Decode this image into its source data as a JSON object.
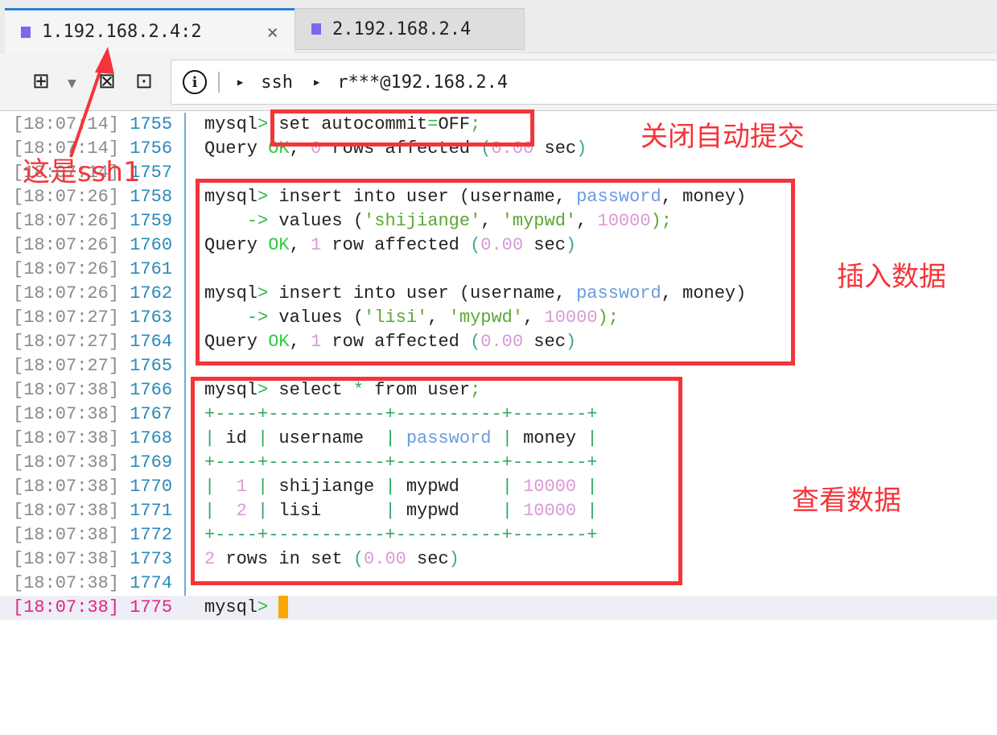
{
  "tabs": [
    {
      "label": "1.192.168.2.4:2",
      "active": true,
      "close": "×"
    },
    {
      "label": "2.192.168.2.4",
      "active": false
    }
  ],
  "toolbar": {
    "breadcrumb": [
      "ssh",
      "r***@192.168.2.4"
    ]
  },
  "colors": {
    "d": "#222222",
    "g": "#2fb84a",
    "k": "#2ecc40",
    "p": "#d99bd6",
    "b": "#6b9be0",
    "c": "#3aa88a",
    "s": "#5aa832",
    "t": "#2fa860"
  },
  "terminal": {
    "lines": [
      {
        "ts": "[18:07:14]",
        "n": "1755",
        "seg": [
          [
            "mysql",
            "d"
          ],
          [
            ">",
            "g"
          ],
          [
            " set autocommit",
            "d"
          ],
          [
            "=",
            "g"
          ],
          [
            "OFF",
            "d"
          ],
          [
            ";",
            "s"
          ]
        ]
      },
      {
        "ts": "[18:07:14]",
        "n": "1756",
        "seg": [
          [
            "Query ",
            "d"
          ],
          [
            "OK",
            "k"
          ],
          [
            ", ",
            "d"
          ],
          [
            "0",
            "p"
          ],
          [
            " rows affected ",
            "d"
          ],
          [
            "(",
            "c"
          ],
          [
            "0.00",
            "p"
          ],
          [
            " sec",
            "d"
          ],
          [
            ")",
            "c"
          ]
        ]
      },
      {
        "ts": "[18:07:14]",
        "n": "1757",
        "seg": []
      },
      {
        "ts": "[18:07:26]",
        "n": "1758",
        "seg": [
          [
            "mysql",
            "d"
          ],
          [
            ">",
            "g"
          ],
          [
            " insert into user (username, ",
            "d"
          ],
          [
            "password",
            "b"
          ],
          [
            ", money)",
            "d"
          ]
        ]
      },
      {
        "ts": "[18:07:26]",
        "n": "1759",
        "seg": [
          [
            "    ",
            "d"
          ],
          [
            "->",
            "g"
          ],
          [
            " values (",
            "d"
          ],
          [
            "'shijiange'",
            "s"
          ],
          [
            ", ",
            "d"
          ],
          [
            "'mypwd'",
            "s"
          ],
          [
            ", ",
            "d"
          ],
          [
            "10000",
            "p"
          ],
          [
            ");",
            "s"
          ]
        ]
      },
      {
        "ts": "[18:07:26]",
        "n": "1760",
        "seg": [
          [
            "Query ",
            "d"
          ],
          [
            "OK",
            "k"
          ],
          [
            ", ",
            "d"
          ],
          [
            "1",
            "p"
          ],
          [
            " row affected ",
            "d"
          ],
          [
            "(",
            "c"
          ],
          [
            "0.00",
            "p"
          ],
          [
            " sec",
            "d"
          ],
          [
            ")",
            "c"
          ]
        ]
      },
      {
        "ts": "[18:07:26]",
        "n": "1761",
        "seg": []
      },
      {
        "ts": "[18:07:26]",
        "n": "1762",
        "seg": [
          [
            "mysql",
            "d"
          ],
          [
            ">",
            "g"
          ],
          [
            " insert into user (username, ",
            "d"
          ],
          [
            "password",
            "b"
          ],
          [
            ", money)",
            "d"
          ]
        ]
      },
      {
        "ts": "[18:07:27]",
        "n": "1763",
        "seg": [
          [
            "    ",
            "d"
          ],
          [
            "->",
            "g"
          ],
          [
            " values (",
            "d"
          ],
          [
            "'lisi'",
            "s"
          ],
          [
            ", ",
            "d"
          ],
          [
            "'mypwd'",
            "s"
          ],
          [
            ", ",
            "d"
          ],
          [
            "10000",
            "p"
          ],
          [
            ");",
            "s"
          ]
        ]
      },
      {
        "ts": "[18:07:27]",
        "n": "1764",
        "seg": [
          [
            "Query ",
            "d"
          ],
          [
            "OK",
            "k"
          ],
          [
            ", ",
            "d"
          ],
          [
            "1",
            "p"
          ],
          [
            " row affected ",
            "d"
          ],
          [
            "(",
            "c"
          ],
          [
            "0.00",
            "p"
          ],
          [
            " sec",
            "d"
          ],
          [
            ")",
            "c"
          ]
        ]
      },
      {
        "ts": "[18:07:27]",
        "n": "1765",
        "seg": []
      },
      {
        "ts": "[18:07:38]",
        "n": "1766",
        "seg": [
          [
            "mysql",
            "d"
          ],
          [
            ">",
            "g"
          ],
          [
            " select ",
            "d"
          ],
          [
            "*",
            "t"
          ],
          [
            " from user",
            "d"
          ],
          [
            ";",
            "s"
          ]
        ]
      },
      {
        "ts": "[18:07:38]",
        "n": "1767",
        "seg": [
          [
            "+----+-----------+----------+-------+",
            "t"
          ]
        ]
      },
      {
        "ts": "[18:07:38]",
        "n": "1768",
        "seg": [
          [
            "|",
            "t"
          ],
          [
            " id ",
            "d"
          ],
          [
            "|",
            "t"
          ],
          [
            " username  ",
            "d"
          ],
          [
            "|",
            "t"
          ],
          [
            " ",
            "d"
          ],
          [
            "password",
            "b"
          ],
          [
            " ",
            "d"
          ],
          [
            "|",
            "t"
          ],
          [
            " money ",
            "d"
          ],
          [
            "|",
            "t"
          ]
        ]
      },
      {
        "ts": "[18:07:38]",
        "n": "1769",
        "seg": [
          [
            "+----+-----------+----------+-------+",
            "t"
          ]
        ]
      },
      {
        "ts": "[18:07:38]",
        "n": "1770",
        "seg": [
          [
            "|",
            "t"
          ],
          [
            "  ",
            "d"
          ],
          [
            "1",
            "p"
          ],
          [
            " ",
            "d"
          ],
          [
            "|",
            "t"
          ],
          [
            " shijiange ",
            "d"
          ],
          [
            "|",
            "t"
          ],
          [
            " mypwd    ",
            "d"
          ],
          [
            "|",
            "t"
          ],
          [
            " ",
            "d"
          ],
          [
            "10000",
            "p"
          ],
          [
            " ",
            "d"
          ],
          [
            "|",
            "t"
          ]
        ]
      },
      {
        "ts": "[18:07:38]",
        "n": "1771",
        "seg": [
          [
            "|",
            "t"
          ],
          [
            "  ",
            "d"
          ],
          [
            "2",
            "p"
          ],
          [
            " ",
            "d"
          ],
          [
            "|",
            "t"
          ],
          [
            " lisi      ",
            "d"
          ],
          [
            "|",
            "t"
          ],
          [
            " mypwd    ",
            "d"
          ],
          [
            "|",
            "t"
          ],
          [
            " ",
            "d"
          ],
          [
            "10000",
            "p"
          ],
          [
            " ",
            "d"
          ],
          [
            "|",
            "t"
          ]
        ]
      },
      {
        "ts": "[18:07:38]",
        "n": "1772",
        "seg": [
          [
            "+----+-----------+----------+-------+",
            "t"
          ]
        ]
      },
      {
        "ts": "[18:07:38]",
        "n": "1773",
        "seg": [
          [
            "2",
            "p"
          ],
          [
            " rows in set ",
            "d"
          ],
          [
            "(",
            "c"
          ],
          [
            "0.00",
            "p"
          ],
          [
            " sec",
            "d"
          ],
          [
            ")",
            "c"
          ]
        ]
      },
      {
        "ts": "[18:07:38]",
        "n": "1774",
        "seg": []
      },
      {
        "ts": "[18:07:38]",
        "n": "1775",
        "seg": [
          [
            "mysql",
            "d"
          ],
          [
            ">",
            "g"
          ],
          [
            " ",
            "d"
          ]
        ],
        "current": true
      }
    ]
  },
  "annotations": {
    "ssh1": "这是ssh1",
    "autocommit": "关闭自动提交",
    "insert": "插入数据",
    "select": "查看数据"
  }
}
